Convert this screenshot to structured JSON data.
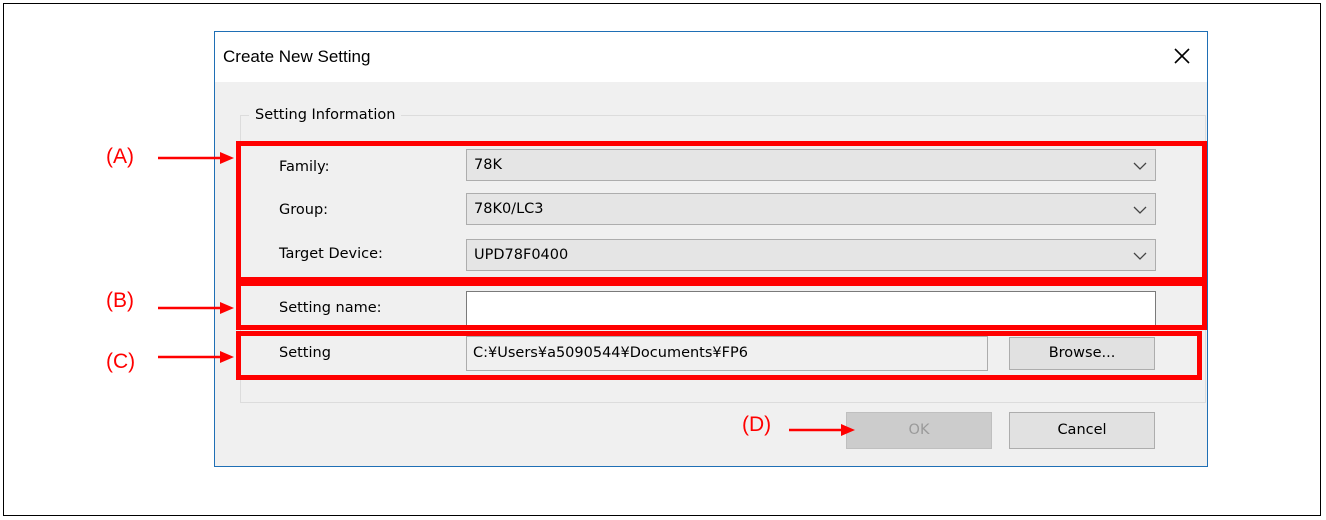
{
  "dialog": {
    "title": "Create New Setting",
    "group_title": "Setting Information",
    "fields": {
      "family": {
        "label": "Family:",
        "value": "78K"
      },
      "group": {
        "label": "Group:",
        "value": "78K0/LC3"
      },
      "target_device": {
        "label": "Target Device:",
        "value": "UPD78F0400"
      },
      "setting_name": {
        "label": "Setting name:",
        "value": ""
      },
      "setting": {
        "label": "Setting",
        "value": "C:¥Users¥a5090544¥Documents¥FP6"
      }
    },
    "buttons": {
      "browse": "Browse...",
      "ok": "OK",
      "cancel": "Cancel"
    }
  },
  "annotations": {
    "a": "(A)",
    "b": "(B)",
    "c": "(C)",
    "d": "(D)"
  },
  "colors": {
    "highlight": "#ff0000",
    "dialog_border": "#1f6fb5",
    "dialog_bg": "#f0f0f0"
  },
  "icons": {
    "close": "close-icon",
    "dropdown": "chevron-down-icon"
  }
}
